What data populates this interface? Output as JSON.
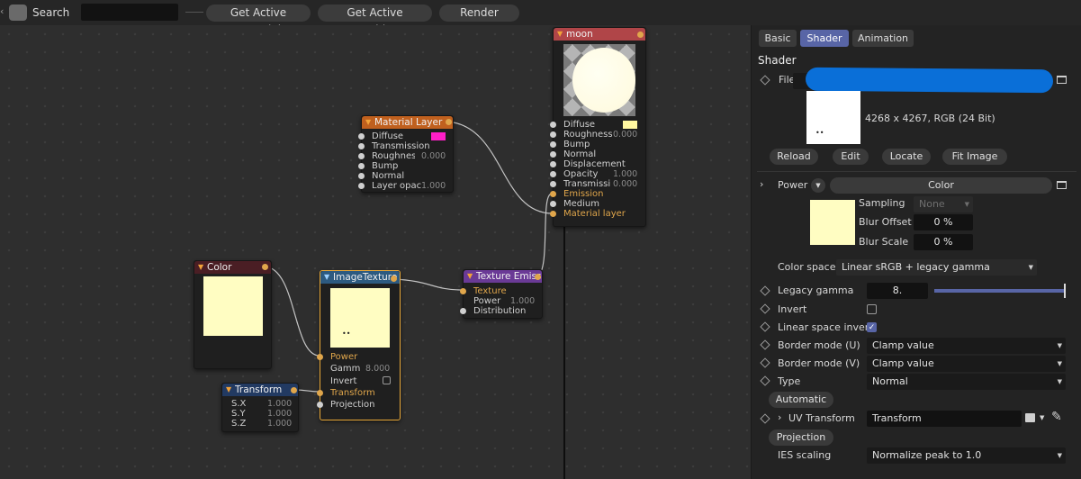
{
  "toolbar": {
    "search_label": "Search",
    "buttons": [
      "Get Active material",
      "Get Active tag/object",
      "Render AOVs"
    ]
  },
  "nodes": {
    "moon": {
      "title": "moon",
      "inputs": [
        "Diffuse",
        "Roughness",
        "Bump",
        "Normal",
        "Displacement",
        "Opacity",
        "Transmissi",
        "Emission",
        "Medium",
        "Material layer"
      ],
      "roughness": "0.000",
      "opacity": "1.000",
      "transmission": "0.000",
      "diffuse_swatch": "#fff7a0"
    },
    "material_layer": {
      "title": "Material Layer",
      "inputs": [
        "Diffuse",
        "Transmission",
        "Roughness",
        "Bump",
        "Normal",
        "Layer opac"
      ],
      "roughness": "0.000",
      "layer_opacity": "1.000",
      "diffuse_swatch": "#ff1ec8"
    },
    "color": {
      "title": "Color",
      "swatch": "#fffdc2"
    },
    "image_texture": {
      "title": "ImageTexture",
      "inputs": [
        "Power",
        "Gamma",
        "Invert",
        "Transform",
        "Projection"
      ],
      "gamma": "8.000"
    },
    "texture_emission": {
      "title": "Texture Emiss",
      "inputs": [
        "Texture",
        "Power",
        "Distribution"
      ],
      "power": "1.000"
    },
    "transform": {
      "title": "Transform",
      "rows": [
        "S.X",
        "S.Y",
        "S.Z"
      ],
      "values": [
        "1.000",
        "1.000",
        "1.000"
      ]
    }
  },
  "panel": {
    "tabs": [
      "Basic",
      "Shader",
      "Animation"
    ],
    "active_tab": "Shader",
    "section_title": "Shader",
    "file_label": "File",
    "image_info": "4268 x 4267, RGB (24 Bit)",
    "image_buttons": [
      "Reload",
      "Edit",
      "Locate",
      "Fit Image"
    ],
    "power_label": "Power",
    "power_value": "Color",
    "power_swatch": "#fffdc2",
    "sampling_label": "Sampling",
    "sampling_value": "None",
    "blur_offset_label": "Blur Offset",
    "blur_offset_value": "0 %",
    "blur_scale_label": "Blur Scale",
    "blur_scale_value": "0 %",
    "color_space_label": "Color space",
    "color_space_value": "Linear sRGB + legacy gamma",
    "legacy_gamma_label": "Legacy gamma",
    "legacy_gamma_value": "8.",
    "legacy_gamma_fraction": 1.0,
    "invert_label": "Invert",
    "invert_checked": false,
    "linear_space_label": "Linear space invert",
    "linear_space_checked": true,
    "border_u_label": "Border mode (U)",
    "border_u_value": "Clamp value",
    "border_v_label": "Border mode (V)",
    "border_v_value": "Clamp value",
    "type_label": "Type",
    "type_value": "Normal",
    "automatic_label": "Automatic",
    "uv_label": "UV Transform",
    "uv_value": "Transform",
    "projection_label": "Projection",
    "ies_label": "IES scaling",
    "ies_value": "Normalize peak to 1.0"
  },
  "colors": {
    "accent": "#5865a6",
    "scribble": "#0a6fd8"
  }
}
